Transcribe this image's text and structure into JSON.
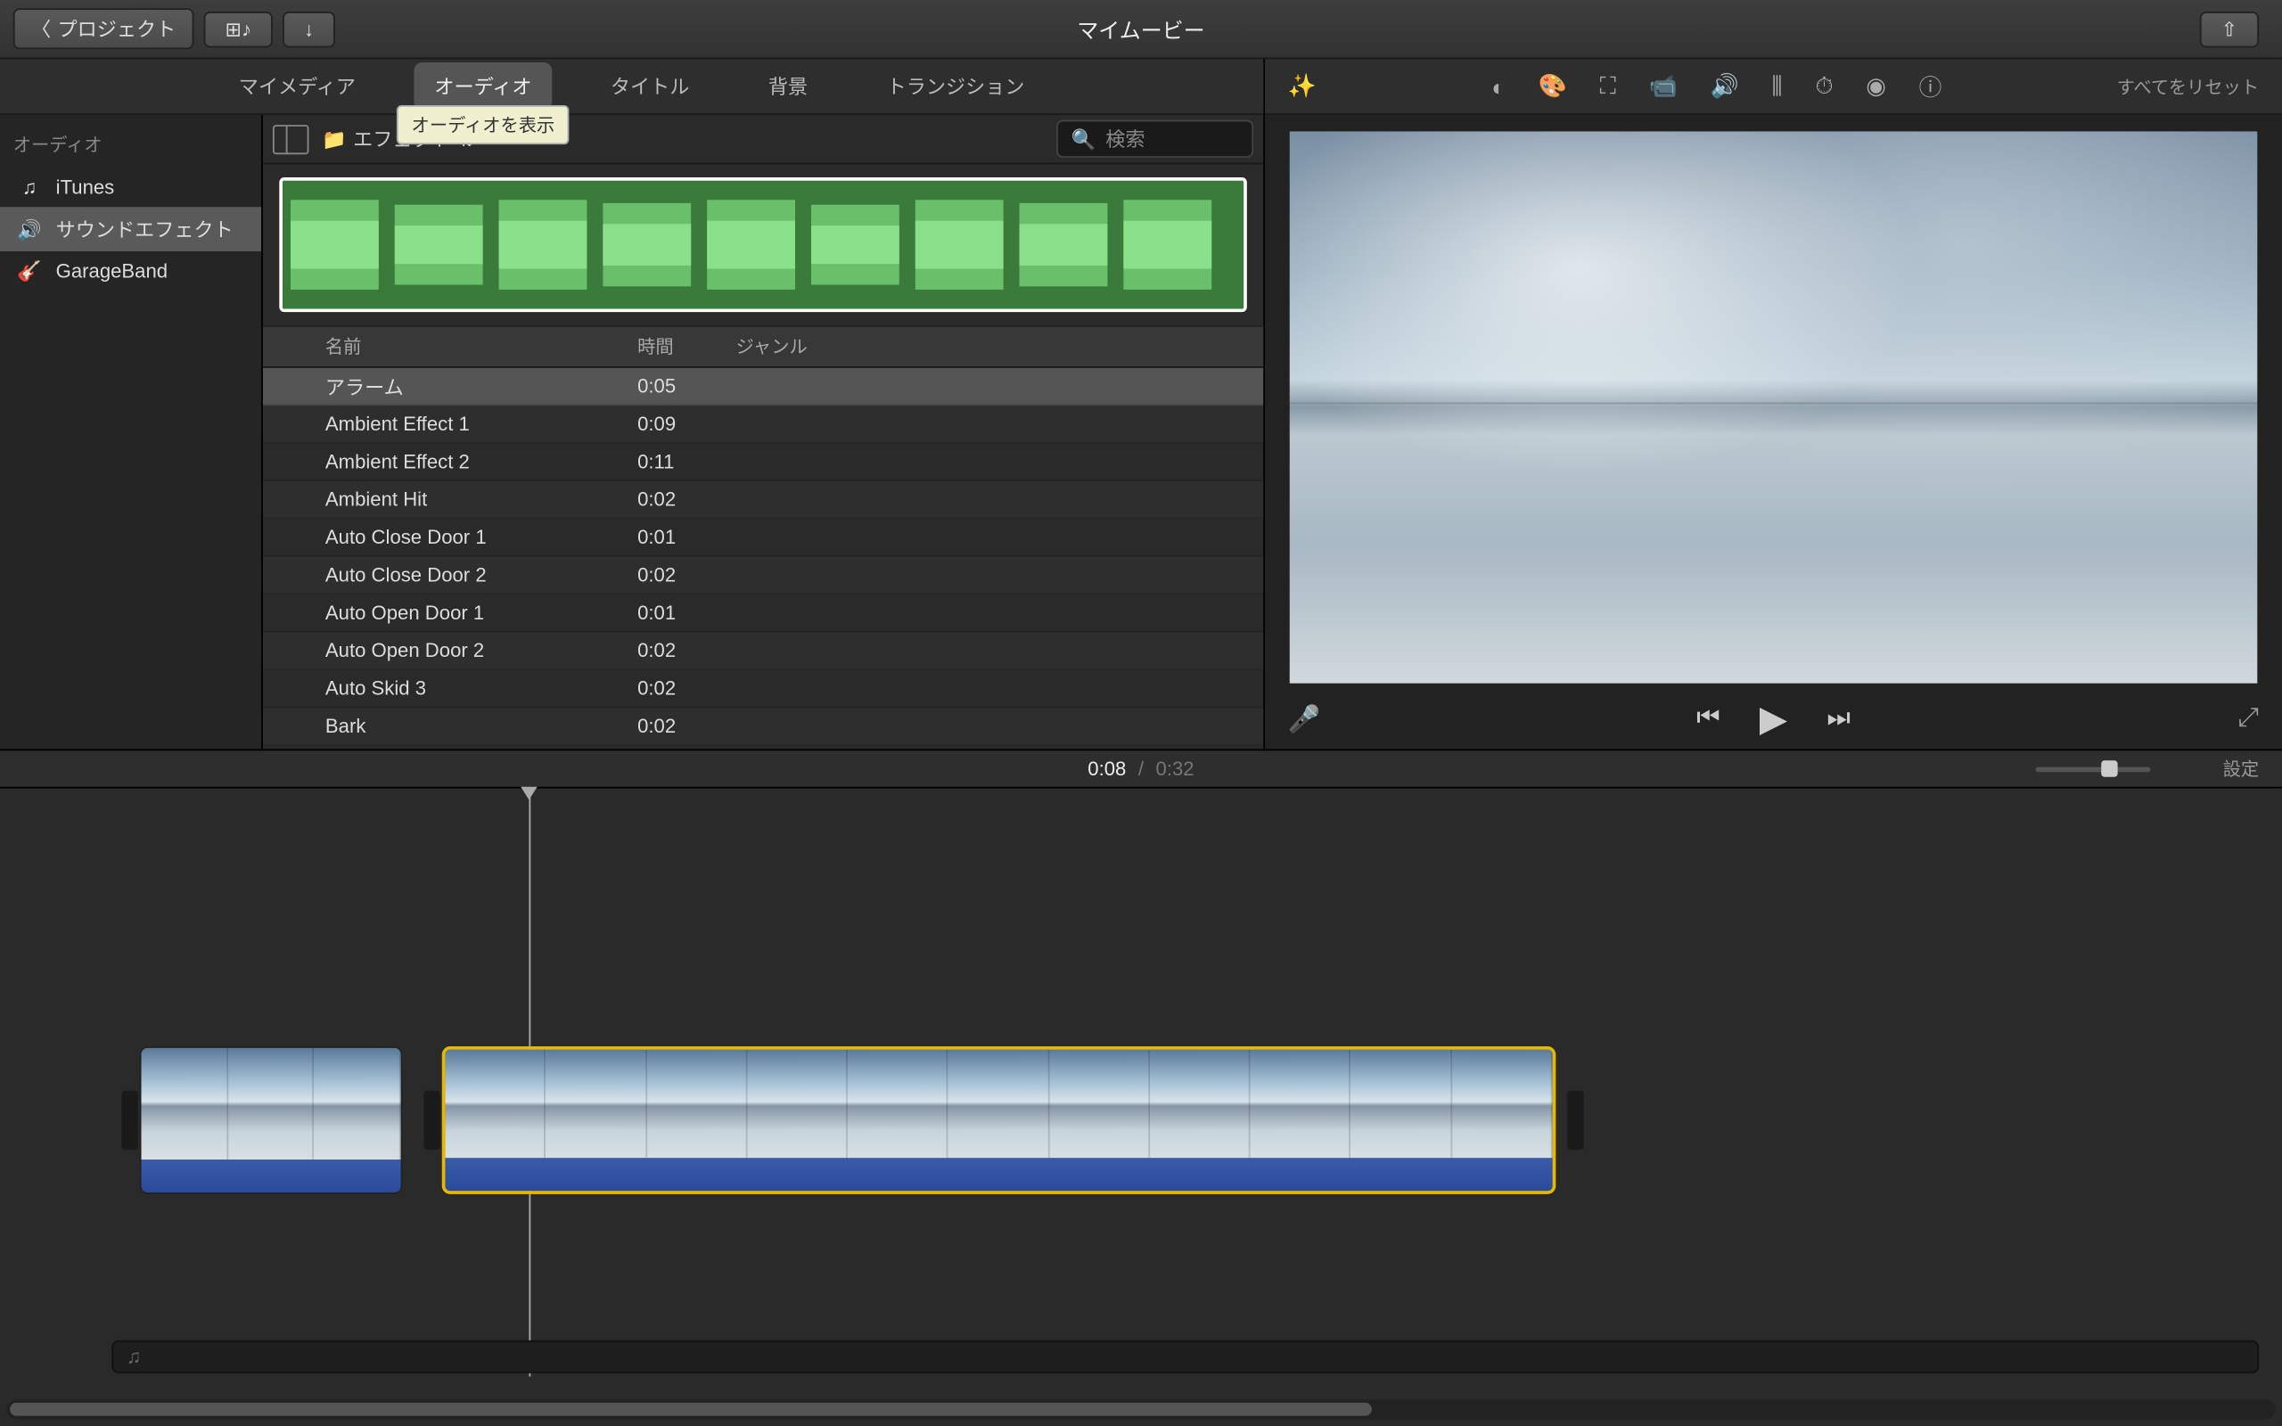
{
  "topbar": {
    "back_label": "プロジェクト",
    "title": "マイムービー"
  },
  "tabs": {
    "media": "マイメディア",
    "audio": "オーディオ",
    "titles": "タイトル",
    "backgrounds": "背景",
    "transitions": "トランジション",
    "tooltip": "オーディオを表示"
  },
  "sidebar": {
    "header": "オーディオ",
    "items": [
      {
        "icon": "♫",
        "label": "iTunes"
      },
      {
        "icon": "🔊",
        "label": "サウンドエフェクト"
      },
      {
        "icon": "🎸",
        "label": "GarageBand"
      }
    ]
  },
  "content_toolbar": {
    "folder_icon": "📁",
    "effects_label": "エフェクト",
    "search_placeholder": "検索"
  },
  "table": {
    "headers": {
      "name": "名前",
      "time": "時間",
      "genre": "ジャンル"
    },
    "rows": [
      {
        "name": "アラーム",
        "time": "0:05"
      },
      {
        "name": "Ambient Effect 1",
        "time": "0:09"
      },
      {
        "name": "Ambient Effect 2",
        "time": "0:11"
      },
      {
        "name": "Ambient Hit",
        "time": "0:02"
      },
      {
        "name": "Auto Close Door 1",
        "time": "0:01"
      },
      {
        "name": "Auto Close Door 2",
        "time": "0:02"
      },
      {
        "name": "Auto Open Door 1",
        "time": "0:01"
      },
      {
        "name": "Auto Open Door 2",
        "time": "0:02"
      },
      {
        "name": "Auto Skid 3",
        "time": "0:02"
      },
      {
        "name": "Bark",
        "time": "0:02"
      }
    ]
  },
  "adjust": {
    "reset": "すべてをリセット"
  },
  "timeline": {
    "current": "0:08",
    "separator": "/",
    "total": "0:32",
    "settings": "設定",
    "audio_track_icon": "♫"
  }
}
